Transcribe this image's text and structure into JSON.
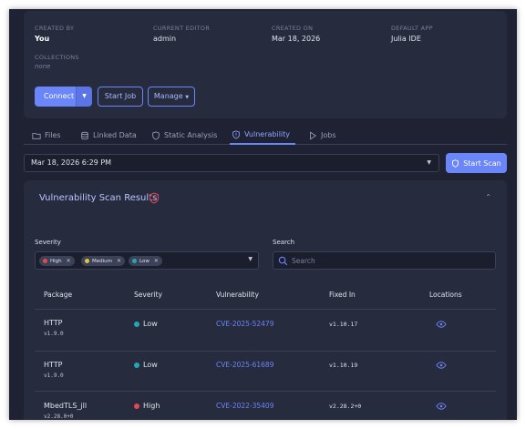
{
  "meta": {
    "created_by_label": "CREATED BY",
    "created_by": "You",
    "editor_label": "CURRENT EDITOR",
    "editor": "admin",
    "created_on_label": "CREATED ON",
    "created_on": "Mar 18, 2026",
    "default_app_label": "DEFAULT APP",
    "default_app": "Julia IDE",
    "collections_label": "COLLECTIONS",
    "collections": "none"
  },
  "actions": {
    "connect": "Connect",
    "start_job": "Start Job",
    "manage": "Manage"
  },
  "tabs": [
    {
      "label": "Files",
      "icon": "folder-icon"
    },
    {
      "label": "Linked Data",
      "icon": "database-icon"
    },
    {
      "label": "Static Analysis",
      "icon": "shield-icon"
    },
    {
      "label": "Vulnerability",
      "icon": "shield-alert-icon",
      "active": true
    },
    {
      "label": "Jobs",
      "icon": "play-icon"
    }
  ],
  "scan": {
    "selected_date": "Mar 18, 2026 6:29 PM",
    "start_scan": "Start Scan",
    "results_title": "Vulnerability Scan Results",
    "severity_label": "Severity",
    "search_label": "Search",
    "search_placeholder": "Search",
    "severity_filters": [
      {
        "label": "High",
        "color": "#e5484d"
      },
      {
        "label": "Medium",
        "color": "#e8c33a"
      },
      {
        "label": "Low",
        "color": "#1fa9b8"
      }
    ]
  },
  "table": {
    "headers": [
      "Package",
      "Severity",
      "Vulnerability",
      "Fixed In",
      "Locations"
    ],
    "rows": [
      {
        "package": "HTTP",
        "version": "v1.9.0",
        "severity": "Low",
        "severity_color": "#1fa9b8",
        "vulnerability": "CVE-2025-52479",
        "fixed_in": "v1.10.17"
      },
      {
        "package": "HTTP",
        "version": "v1.9.0",
        "severity": "Low",
        "severity_color": "#1fa9b8",
        "vulnerability": "CVE-2025-61689",
        "fixed_in": "v1.10.19"
      },
      {
        "package": "MbedTLS_jll",
        "version": "v2.28.0+0",
        "severity": "High",
        "severity_color": "#e5484d",
        "vulnerability": "CVE-2022-35409",
        "fixed_in": "v2.28.2+0"
      }
    ]
  },
  "colors": {
    "accent": "#6b86f8",
    "background": "#1e2233",
    "card": "#262b3e"
  }
}
